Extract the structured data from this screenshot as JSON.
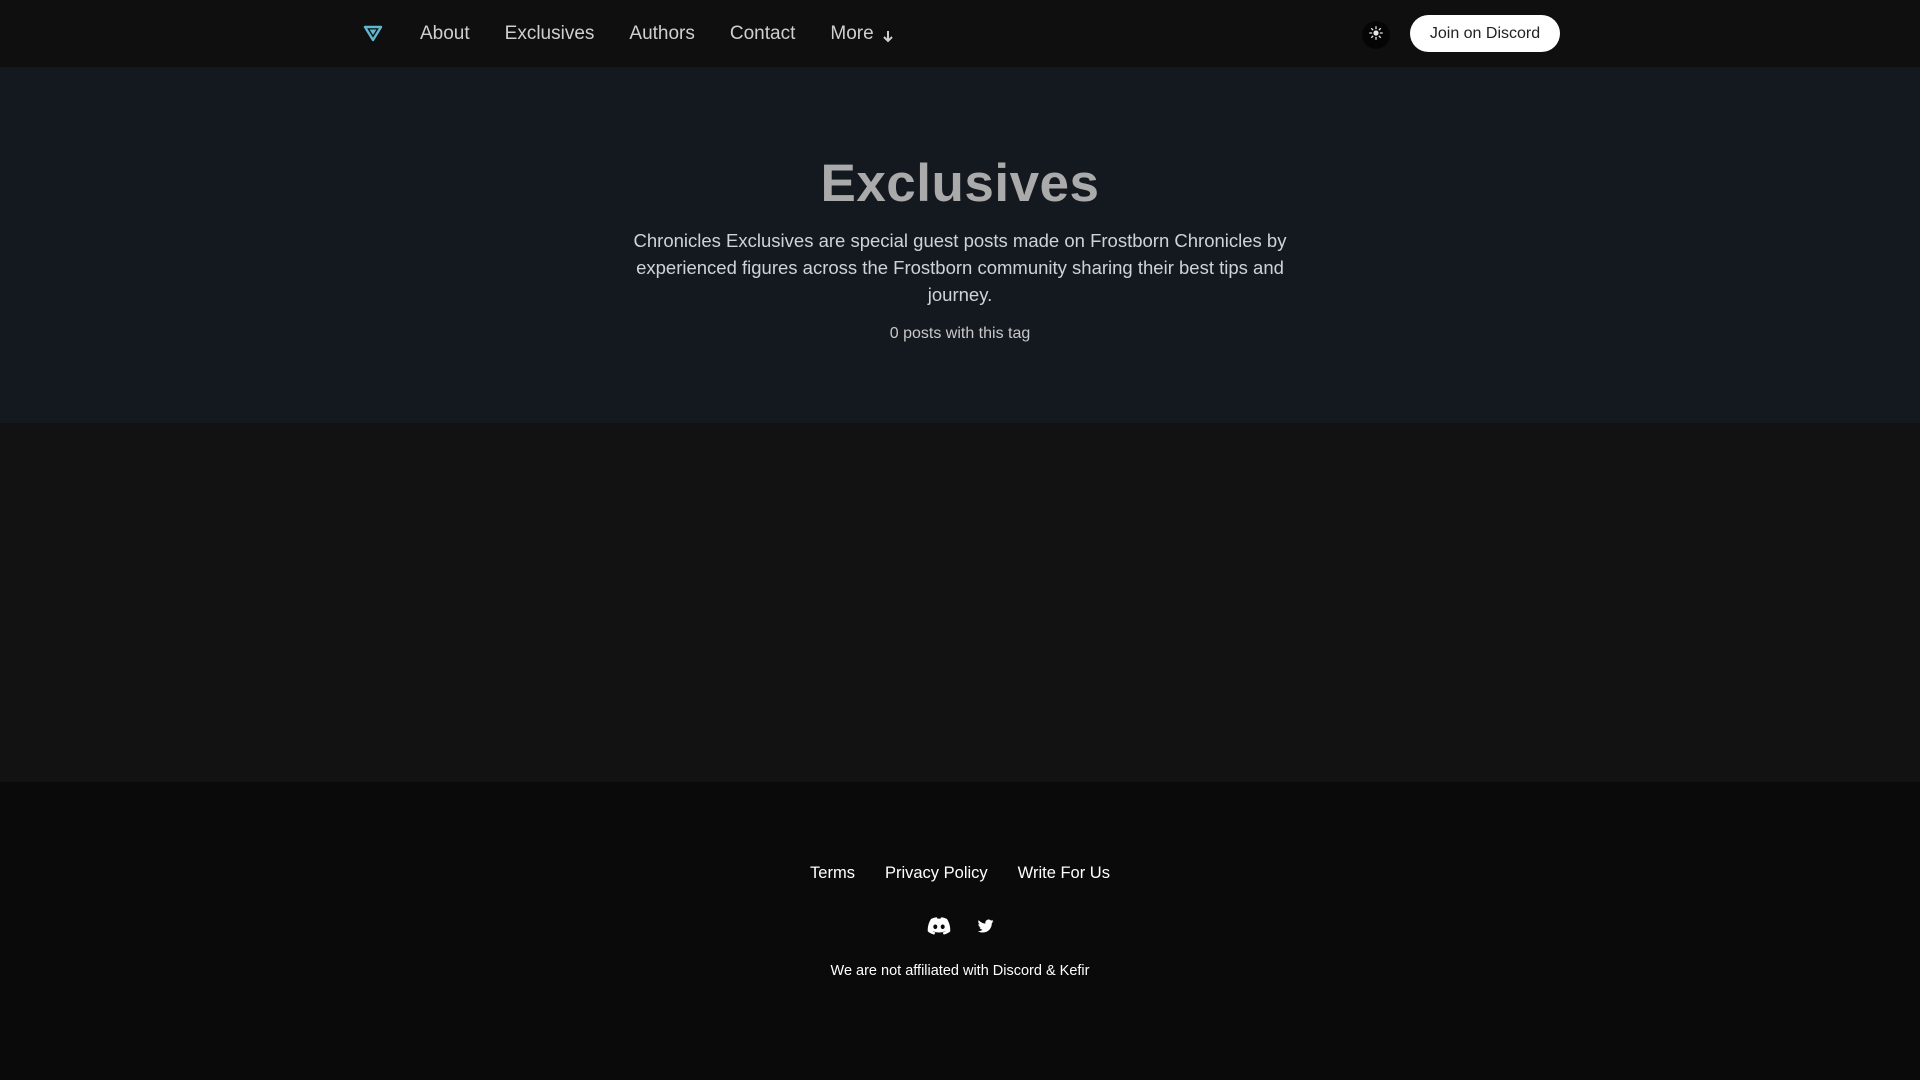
{
  "header": {
    "logo_icon": "triangle-logo-icon",
    "nav": [
      {
        "label": "About"
      },
      {
        "label": "Exclusives"
      },
      {
        "label": "Authors"
      },
      {
        "label": "Contact"
      },
      {
        "label": "More"
      }
    ],
    "more_icon": "arrow-down-icon",
    "theme_toggle_icon": "sun-icon",
    "cta_label": "Join on Discord"
  },
  "hero": {
    "title": "Exclusives",
    "description": "Chronicles Exclusives are special guest posts made on Frostborn Chronicles by experienced figures across the Frostborn community sharing their best tips and journey.",
    "post_count": "0 posts with this tag"
  },
  "footer": {
    "links": [
      {
        "label": "Terms"
      },
      {
        "label": "Privacy Policy"
      },
      {
        "label": "Write For Us"
      }
    ],
    "social_icons": [
      "discord-icon",
      "twitter-icon"
    ],
    "note": "We are not affiliated with Discord & Kefir"
  },
  "colors": {
    "header_bg": "#0f0f0f",
    "hero_bg": "#141920",
    "page_bg": "#121212",
    "footer_bg": "#0a0a0a",
    "logo_accent": "#5fb8d0"
  }
}
